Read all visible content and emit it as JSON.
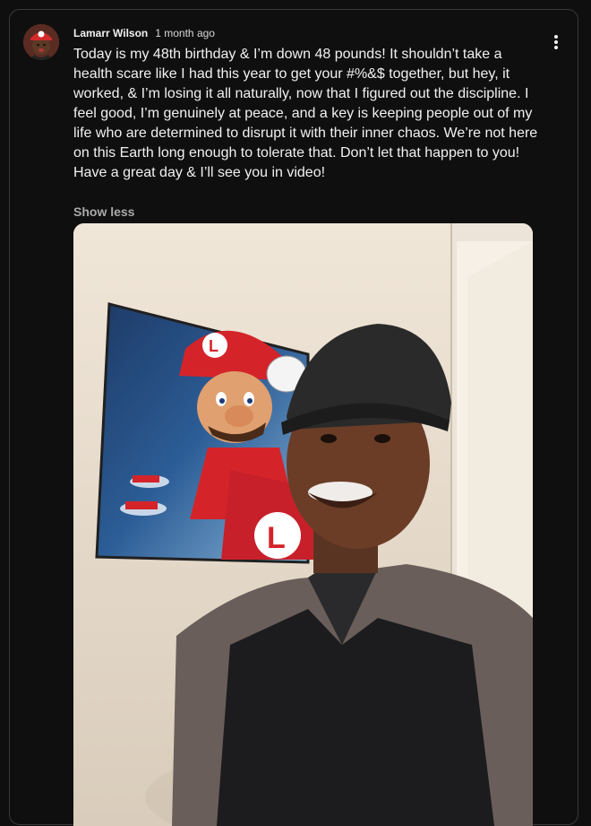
{
  "post": {
    "author": "Lamarr Wilson",
    "timestamp": "1 month ago",
    "body_paragraph_1": "Today is my 48th birthday & I’m down 48 pounds! It shouldn’t take a health scare like I had this year to get your #%&$ together, but hey, it worked, & I’m losing it all naturally, now that I figured out the discipline. I feel good, I’m genuinely at peace, and a key is keeping people out of my life who are determined to disrupt it with their inner chaos. We’re not here on this Earth long enough to tolerate that. Don’t let that happen to you!",
    "body_paragraph_2": "Have a great day & I’ll see you in video!",
    "show_less_label": "Show less",
    "menu_icon": "more-vert-icon",
    "avatar_icon": "avatar",
    "image_icon": "post-photo"
  },
  "colors": {
    "background": "#0f0f0f",
    "card_border": "#3a3a3a",
    "text_primary": "#f1f1f1",
    "text_secondary": "#aaaaaa"
  }
}
